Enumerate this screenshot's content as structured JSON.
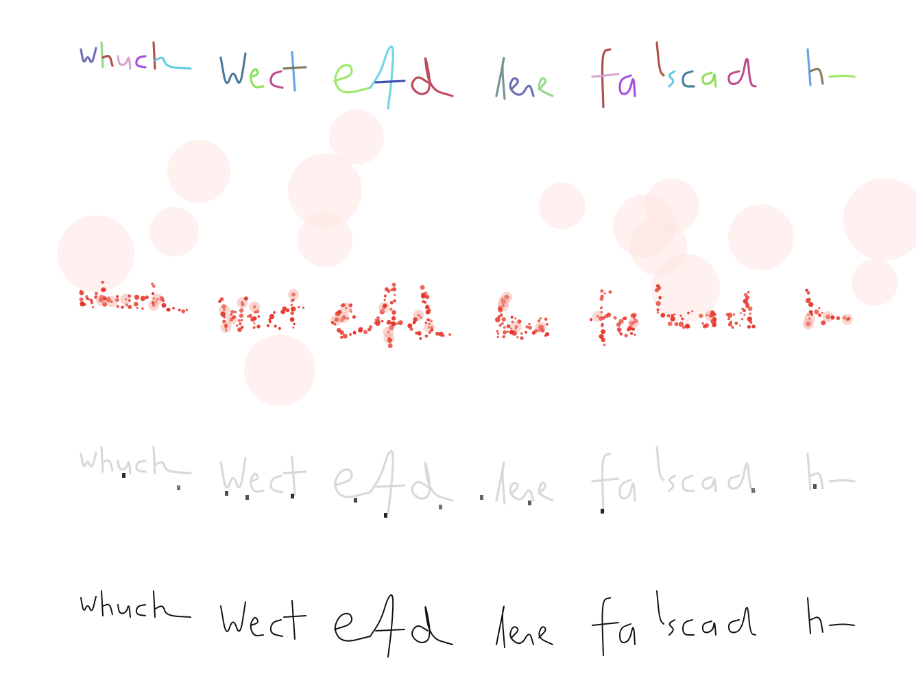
{
  "figure": {
    "words": [
      "whuch",
      "Wect",
      "elfd",
      "lere",
      "fa",
      "lscad",
      "ho"
    ],
    "rows": [
      {
        "name": "row-segment-colored",
        "style": "segments",
        "colors": [
          "#5d5ea8",
          "#8ad67c",
          "#a43c3c",
          "#d59fcd",
          "#9a3fdc",
          "#a54030",
          "#58c8e0",
          "#3a6d95",
          "#82dd4a",
          "#b8397e",
          "#5a97e6",
          "#7a6e52",
          "#94e65c",
          "#64d0e2",
          "#2a3eae",
          "#b83848",
          "#6a8a8a"
        ]
      },
      {
        "name": "row-point-cloud",
        "style": "points",
        "colors": [
          "#e6352a",
          "#fde6e2"
        ]
      },
      {
        "name": "row-grayscale-attention",
        "style": "gray",
        "colors": [
          "#d9d9d9",
          "#1a1a1a"
        ]
      },
      {
        "name": "row-plain-ink",
        "style": "ink",
        "colors": [
          "#111111"
        ]
      }
    ]
  }
}
